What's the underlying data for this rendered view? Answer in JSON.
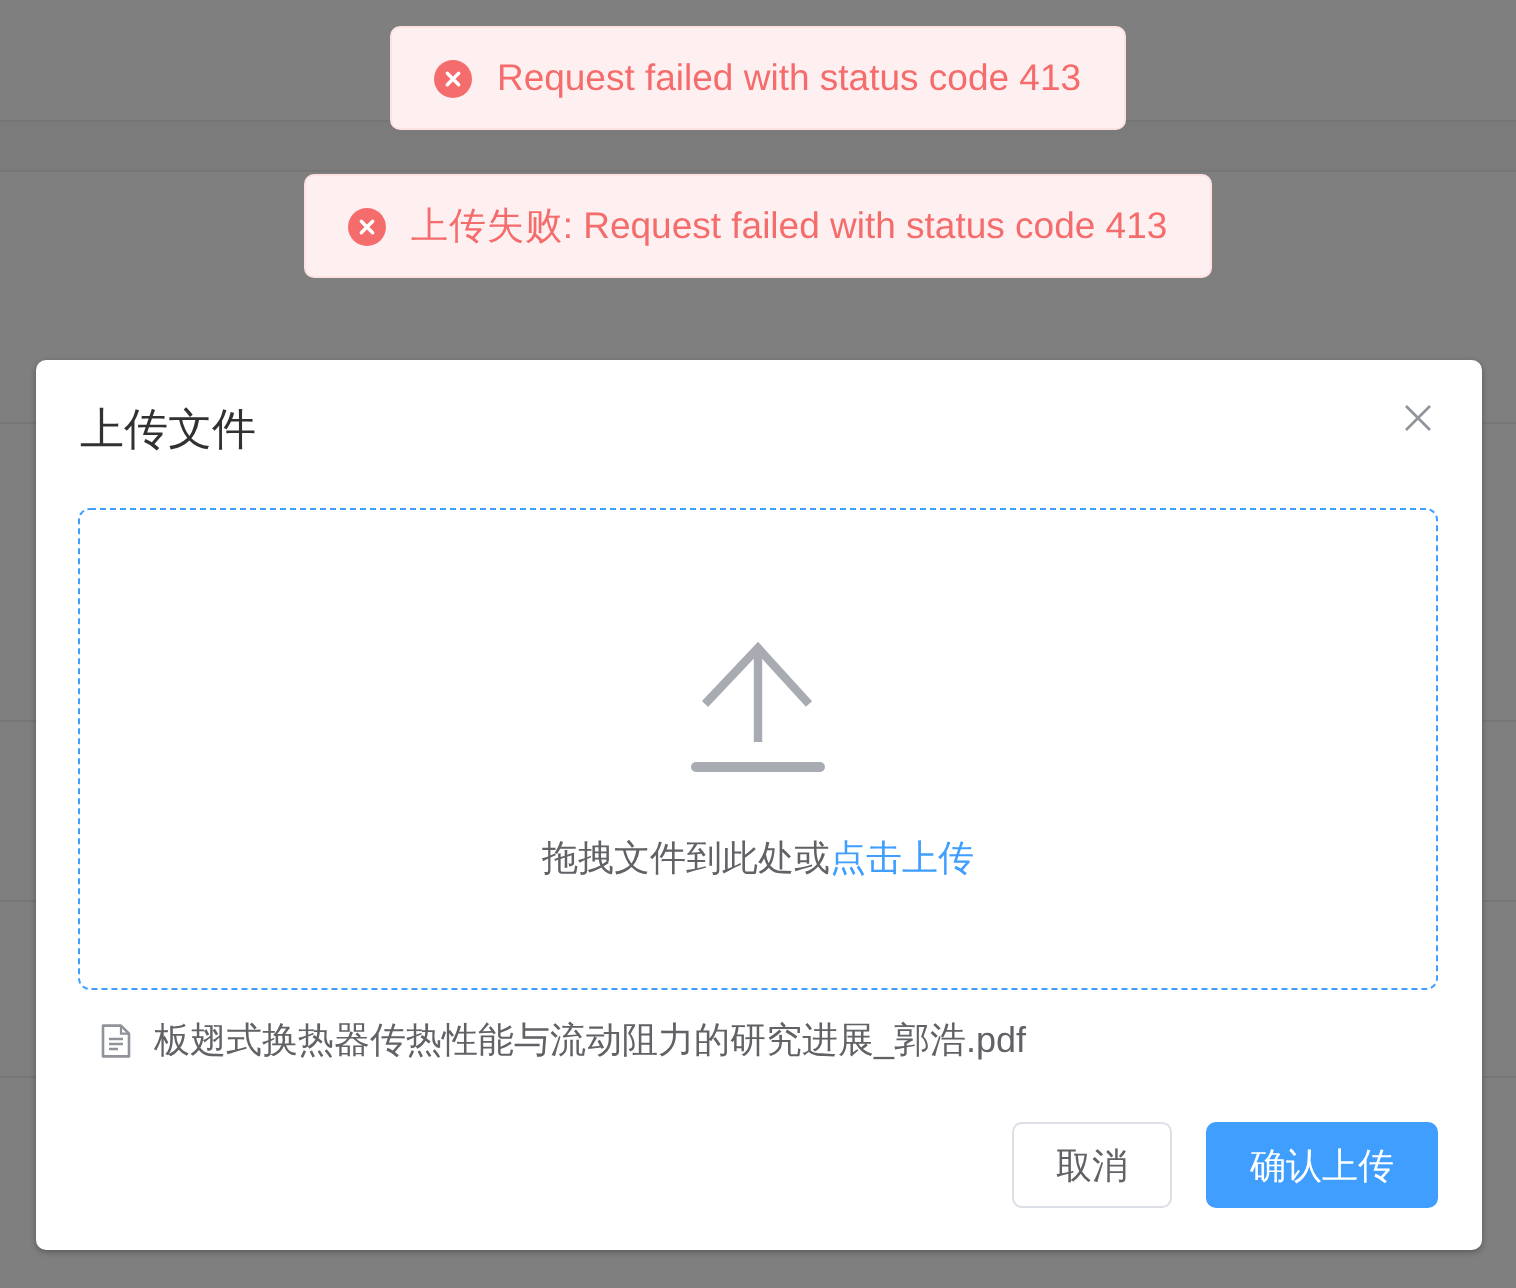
{
  "messages": [
    {
      "kind": "error",
      "text": "Request failed with status code 413"
    },
    {
      "kind": "error",
      "text": "上传失败: Request failed with status code 413"
    }
  ],
  "dialog": {
    "title": "上传文件",
    "upload": {
      "hint": "拖拽文件到此处或",
      "link": "点击上传"
    },
    "files": [
      {
        "name": "板翅式换热器传热性能与流动阻力的研究进展_郭浩.pdf"
      }
    ],
    "buttons": [
      {
        "kind": "default",
        "label": "取消"
      },
      {
        "kind": "primary",
        "label": "确认上传"
      }
    ]
  }
}
